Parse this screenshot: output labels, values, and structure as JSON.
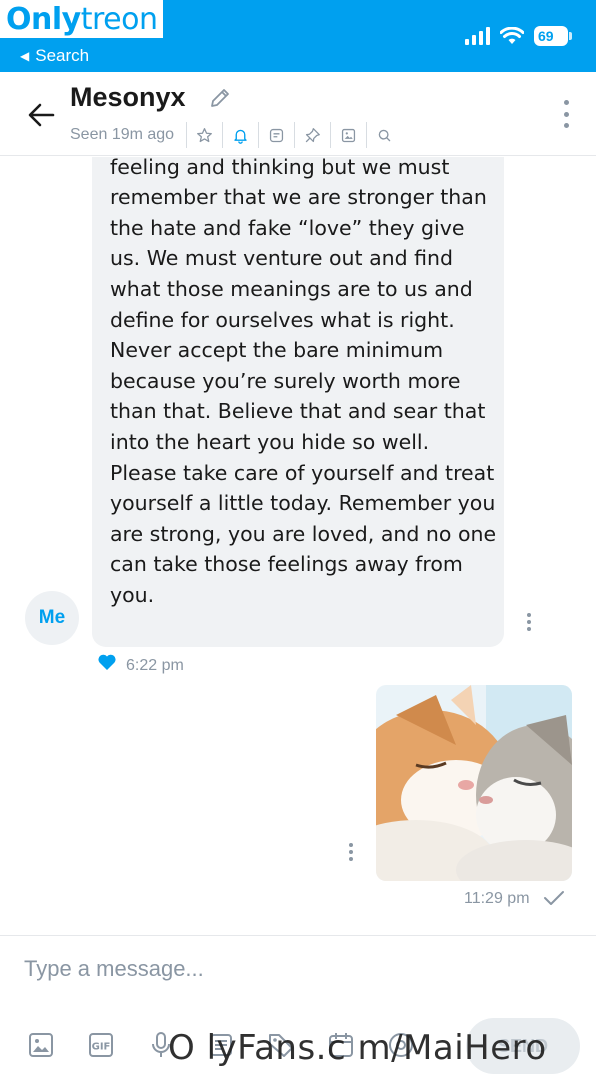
{
  "status_bar": {
    "back_label": "Search",
    "battery": "69",
    "color": "#00a0ef"
  },
  "watermark_top": {
    "part1": "Only",
    "part2": "treon"
  },
  "header": {
    "name": "Mesonyx",
    "seen": "Seen 19m ago",
    "icons": [
      "back-arrow-icon",
      "edit-icon",
      "star-icon",
      "bell-icon",
      "note-icon",
      "pin-icon",
      "gallery-icon",
      "search-icon",
      "more-vertical-icon"
    ]
  },
  "messages": [
    {
      "sender": "Me",
      "avatar_label": "Me",
      "text": "incredibly difficult to break that feeling and thinking but we must remember that we are stronger than the hate and fake “love” they give us. We must venture out and find what those meanings are to us and define for ourselves what is right. Never accept the bare minimum because you’re surely worth more than that. Believe that and sear that into the heart you hide so well. Please take care of yourself and treat yourself a little today. Remember you are strong, you are loved, and no one can take those feelings away from you.",
      "time": "6:22 pm",
      "liked": true
    },
    {
      "sender": "Mesonyx",
      "type": "image",
      "image_desc": "two cats nuzzling",
      "time": "11:29 pm",
      "read": true
    }
  ],
  "composer": {
    "placeholder": "Type a message...",
    "send_label": "SEND",
    "tools": [
      "image-icon",
      "gif-icon",
      "microphone-icon",
      "template-icon",
      "price-tag-icon",
      "calendar-icon",
      "at-icon"
    ]
  },
  "watermark_bottom": "O lyFans.c m/MaiHero",
  "colors": {
    "accent": "#00a0ef",
    "muted": "#8a96a3",
    "bubble": "#f0f2f4"
  }
}
